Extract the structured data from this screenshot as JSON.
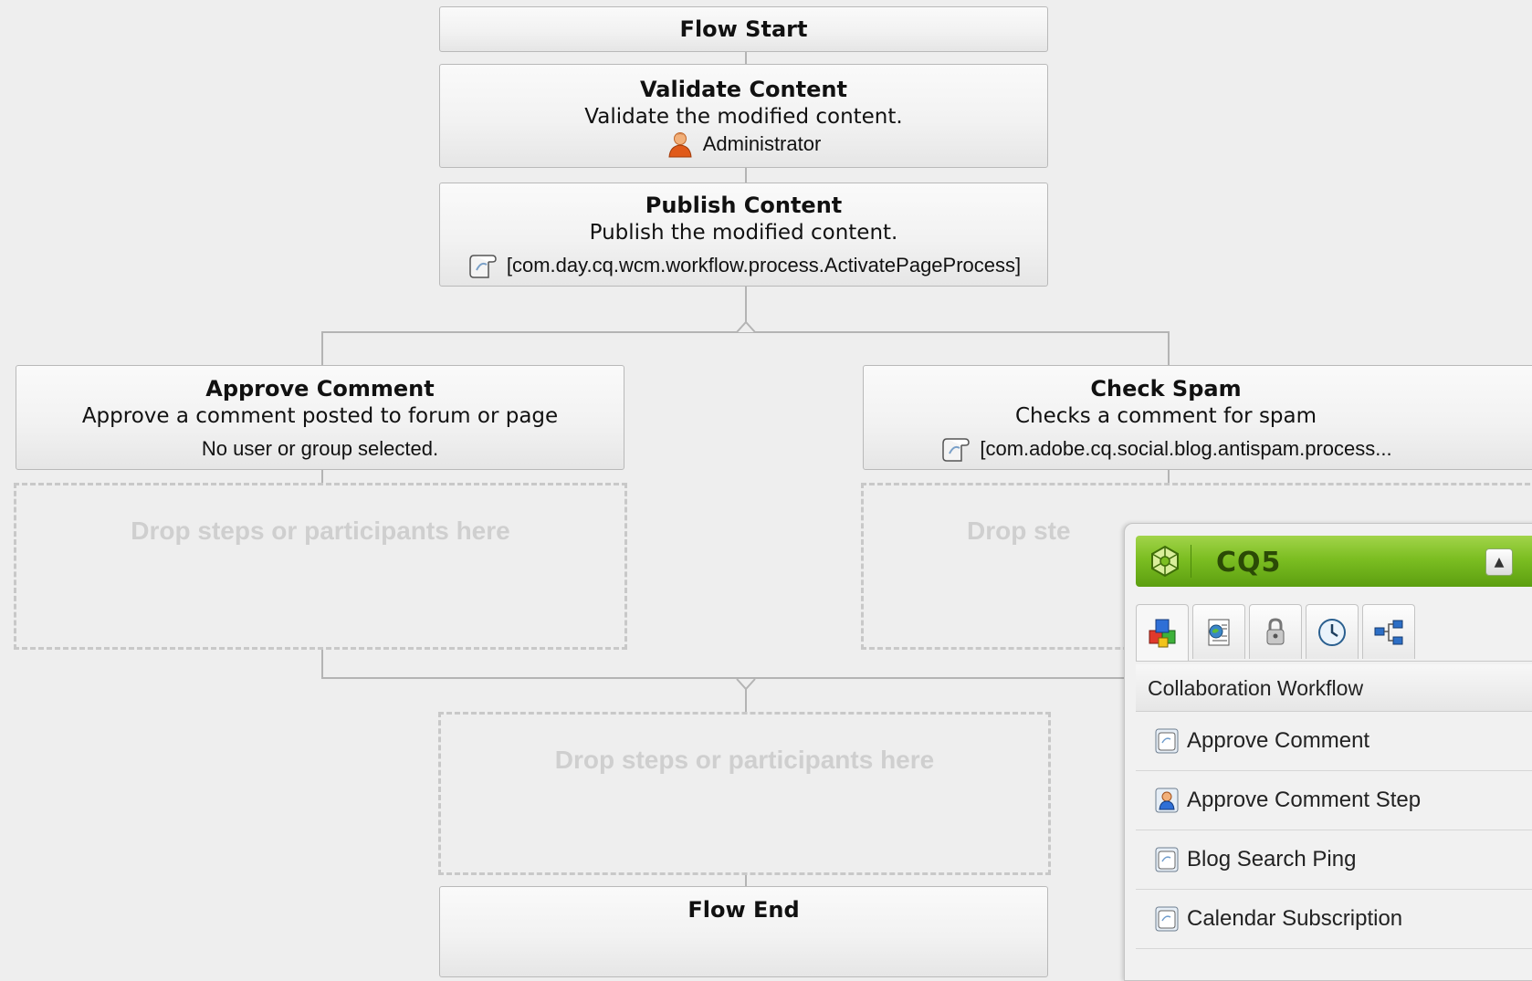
{
  "flow": {
    "start": "Flow Start",
    "end": "Flow End",
    "steps": [
      {
        "title": "Validate Content",
        "description": "Validate the modified content.",
        "meta": "Administrator",
        "meta_icon": "user-icon"
      },
      {
        "title": "Publish Content",
        "description": "Publish the modified content.",
        "meta": "[com.day.cq.wcm.workflow.process.ActivatePageProcess]",
        "meta_icon": "process-script-icon"
      }
    ],
    "branches": [
      {
        "title": "Approve Comment",
        "description": "Approve a comment posted to forum or page",
        "meta": "No user or group selected."
      },
      {
        "title": "Check Spam",
        "description": "Checks a comment for spam",
        "meta": "[com.adobe.cq.social.blog.antispam.process...",
        "meta_icon": "process-script-icon"
      }
    ],
    "drop_text_left": "Drop steps or participants here",
    "drop_text_right": "Drop ste",
    "drop_text_bottom": "Drop steps or participants here"
  },
  "sidekick": {
    "title": "CQ5",
    "brand_color": "#7cbe22",
    "tabs": [
      "components-icon",
      "page-icon",
      "lock-icon",
      "clock-icon",
      "workflow-icon"
    ],
    "section": "Collaboration Workflow",
    "items": [
      {
        "label": "Approve Comment",
        "icon": "process-step-icon"
      },
      {
        "label": "Approve Comment Step",
        "icon": "participant-step-icon"
      },
      {
        "label": "Blog Search Ping",
        "icon": "process-step-icon"
      },
      {
        "label": "Calendar Subscription",
        "icon": "process-step-icon"
      }
    ]
  }
}
